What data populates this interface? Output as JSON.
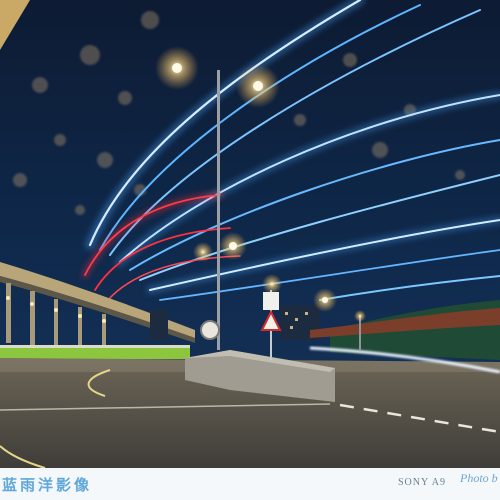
{
  "photo": {
    "subject": "Night long-exposure of vehicle light trails on a curved flyover",
    "colors": {
      "trail_blue": "#57b4ff",
      "trail_red": "#ff2a3a",
      "sky": "#0b1a33",
      "road": "#4b4a45"
    }
  },
  "footer": {
    "brand_text": "蓝雨洋影像",
    "camera_text": "SONY A9",
    "signature_text": "Photo b"
  }
}
